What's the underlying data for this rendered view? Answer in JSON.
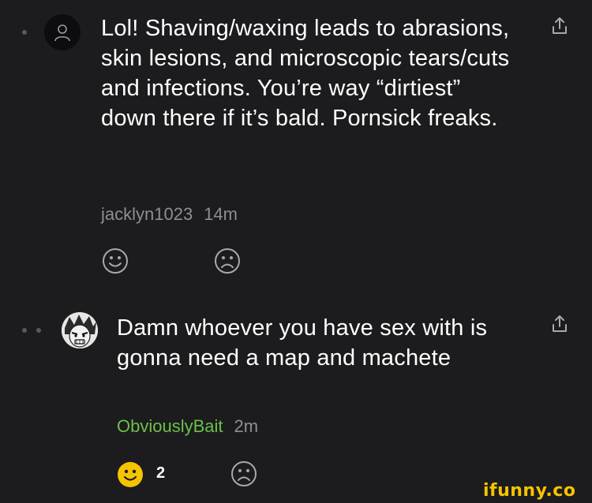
{
  "comments": [
    {
      "text": "Lol! Shaving/waxing leads to abrasions, skin lesions, and microscopic tears/cuts and infections. You’re way “dirtiest” down there if it’s bald. Pornsick freaks.",
      "username": "jacklyn1023",
      "time": "14m",
      "avatar": "default-user-icon",
      "share_icon": "share-icon",
      "like_icon": "smile-icon",
      "dislike_icon": "frown-icon"
    },
    {
      "text": "Damn whoever you have sex with is gonna need a map and machete",
      "username": "ObviouslyBait",
      "time": "2m",
      "avatar": "manga-avatar",
      "share_icon": "share-icon",
      "like_icon": "smile-filled-icon",
      "like_count": "2",
      "dislike_icon": "frown-icon"
    }
  ],
  "watermark": "ifunny.co",
  "colors": {
    "background": "#1c1c1e",
    "text": "#ffffff",
    "meta": "#8e8e93",
    "username_green": "#6cc04a",
    "like_filled": "#f5c400",
    "icon_gray": "#a8a8ad"
  }
}
